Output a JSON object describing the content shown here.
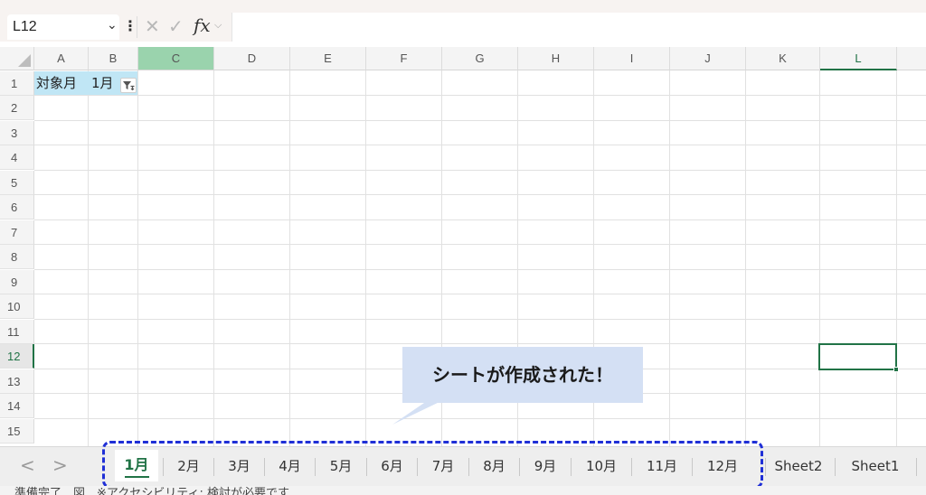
{
  "formula_bar": {
    "name_box": "L12",
    "name_box_chevron": "⌄",
    "kebab": "⋮",
    "cancel_glyph": "✕",
    "enter_glyph": "✓",
    "fx_label": "fx",
    "fx_chevron": "⌵",
    "formula": ""
  },
  "grid": {
    "columns": [
      "A",
      "B",
      "C",
      "D",
      "E",
      "F",
      "G",
      "H",
      "I",
      "J",
      "K",
      "L"
    ],
    "rows": [
      "1",
      "2",
      "3",
      "4",
      "5",
      "6",
      "7",
      "8",
      "9",
      "10",
      "11",
      "12",
      "13",
      "14",
      "15"
    ],
    "highlighted_column": "C",
    "active_column": "L",
    "active_row": "12",
    "active_cell": "L12",
    "cells": {
      "A1": "対象月",
      "B1": "1月"
    },
    "filter_icon": "filter-applied-icon"
  },
  "callout": {
    "text": "シートが作成された！"
  },
  "sheet_tabs": {
    "nav_prev": "<",
    "nav_next": ">",
    "active": "1月",
    "tabs": [
      "2月",
      "3月",
      "4月",
      "5月",
      "6月",
      "7月",
      "8月",
      "9月",
      "10月",
      "11月",
      "12月",
      "Sheet2",
      "Sheet1"
    ]
  },
  "status_bar": {
    "text": "準備完了　図　※アクセシビリティ: 検討が必要です"
  },
  "colors": {
    "excel_green": "#217346",
    "selected_column_header": "#9ad3ad",
    "header_cell_fill": "#c0e6f5",
    "callout_fill": "#d4e0f4",
    "highlight_dash": "#1f2fd6"
  }
}
